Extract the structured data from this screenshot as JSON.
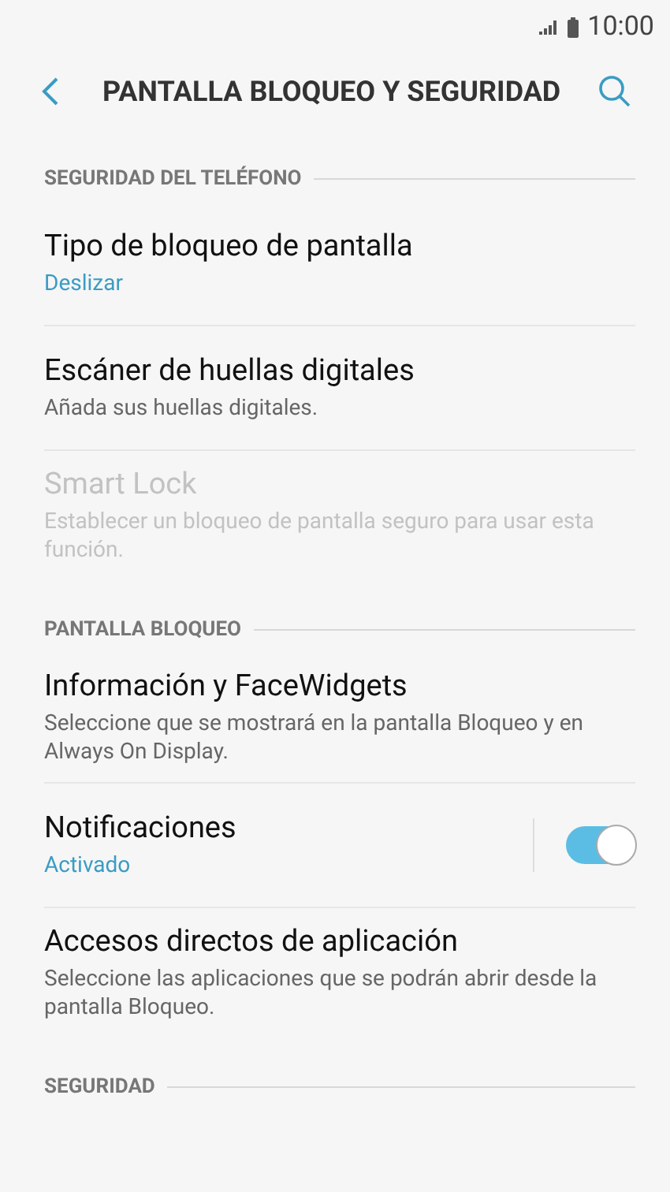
{
  "status_bar": {
    "time": "10:00"
  },
  "header": {
    "title": "PANTALLA BLOQUEO Y SEGURIDAD"
  },
  "sections": [
    {
      "title": "SEGURIDAD DEL TELÉFONO",
      "items": [
        {
          "title": "Tipo de bloqueo de pantalla",
          "subtitle": "Deslizar",
          "kind": "value",
          "disabled": false
        },
        {
          "title": "Escáner de huellas digitales",
          "subtitle": "Añada sus huellas digitales.",
          "kind": "description",
          "disabled": false
        },
        {
          "title": "Smart Lock",
          "subtitle": "Establecer un bloqueo de pantalla seguro para usar esta función.",
          "kind": "description",
          "disabled": true
        }
      ]
    },
    {
      "title": "PANTALLA BLOQUEO",
      "items": [
        {
          "title": "Información y FaceWidgets",
          "subtitle": "Seleccione que se mostrará en la pantalla Bloqueo y en Always On Display.",
          "kind": "description",
          "disabled": false
        },
        {
          "title": "Notificaciones",
          "subtitle": "Activado",
          "kind": "value",
          "disabled": false,
          "toggle": {
            "on": true
          }
        },
        {
          "title": "Accesos directos de aplicación",
          "subtitle": "Seleccione las aplicaciones que se podrán abrir desde la pantalla Bloqueo.",
          "kind": "description",
          "disabled": false
        }
      ]
    },
    {
      "title": "SEGURIDAD"
    }
  ]
}
